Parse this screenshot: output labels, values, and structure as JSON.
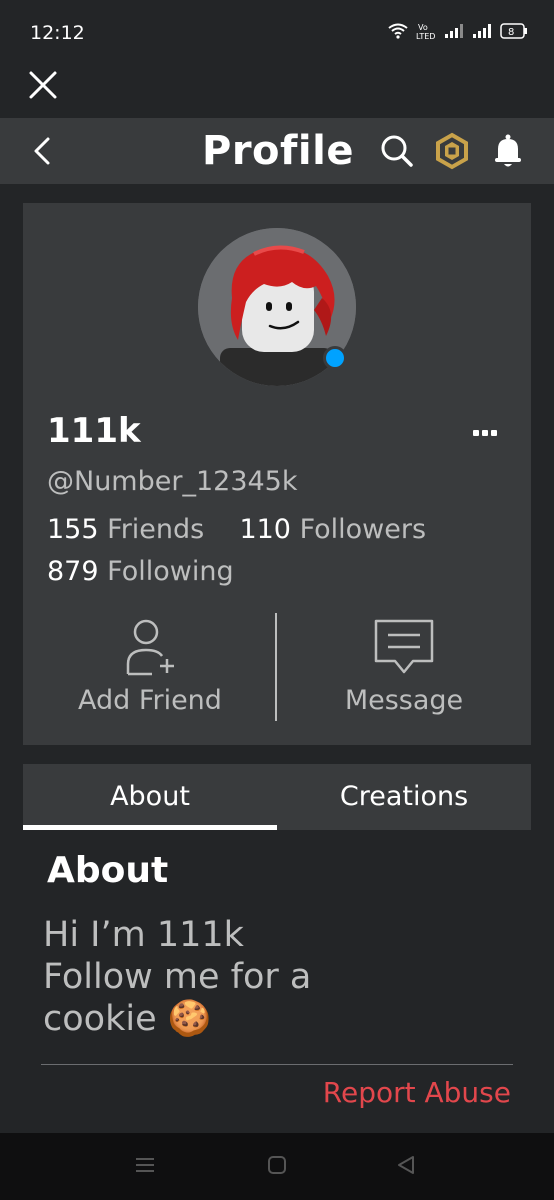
{
  "status_bar": {
    "time": "12:12",
    "volte_label": "Vo\nLTED",
    "battery": "8"
  },
  "header": {
    "title": "Profile"
  },
  "profile": {
    "display_name": "111k",
    "username": "@Number_12345k",
    "friends_count": "155",
    "friends_label": "Friends",
    "followers_count": "110",
    "followers_label": "Followers",
    "following_count": "879",
    "following_label": "Following",
    "online": true
  },
  "actions": {
    "add_friend_label": "Add Friend",
    "message_label": "Message"
  },
  "tabs": [
    {
      "label": "About",
      "active": true
    },
    {
      "label": "Creations",
      "active": false
    }
  ],
  "about": {
    "heading": "About",
    "text": "Hi I’m 111k\nFollow me for a\ncookie 🍪",
    "report_label": "Report Abuse"
  },
  "colors": {
    "background": "#232527",
    "card": "#393b3d",
    "online": "#00a2ff",
    "report": "#e2474c",
    "robux_gold": "#c9a24a"
  },
  "icons": [
    "close-icon",
    "back-icon",
    "search-icon",
    "robux-icon",
    "bell-icon",
    "more-icon",
    "add-friend-icon",
    "message-icon",
    "menu-icon",
    "home-icon",
    "back-nav-icon"
  ]
}
